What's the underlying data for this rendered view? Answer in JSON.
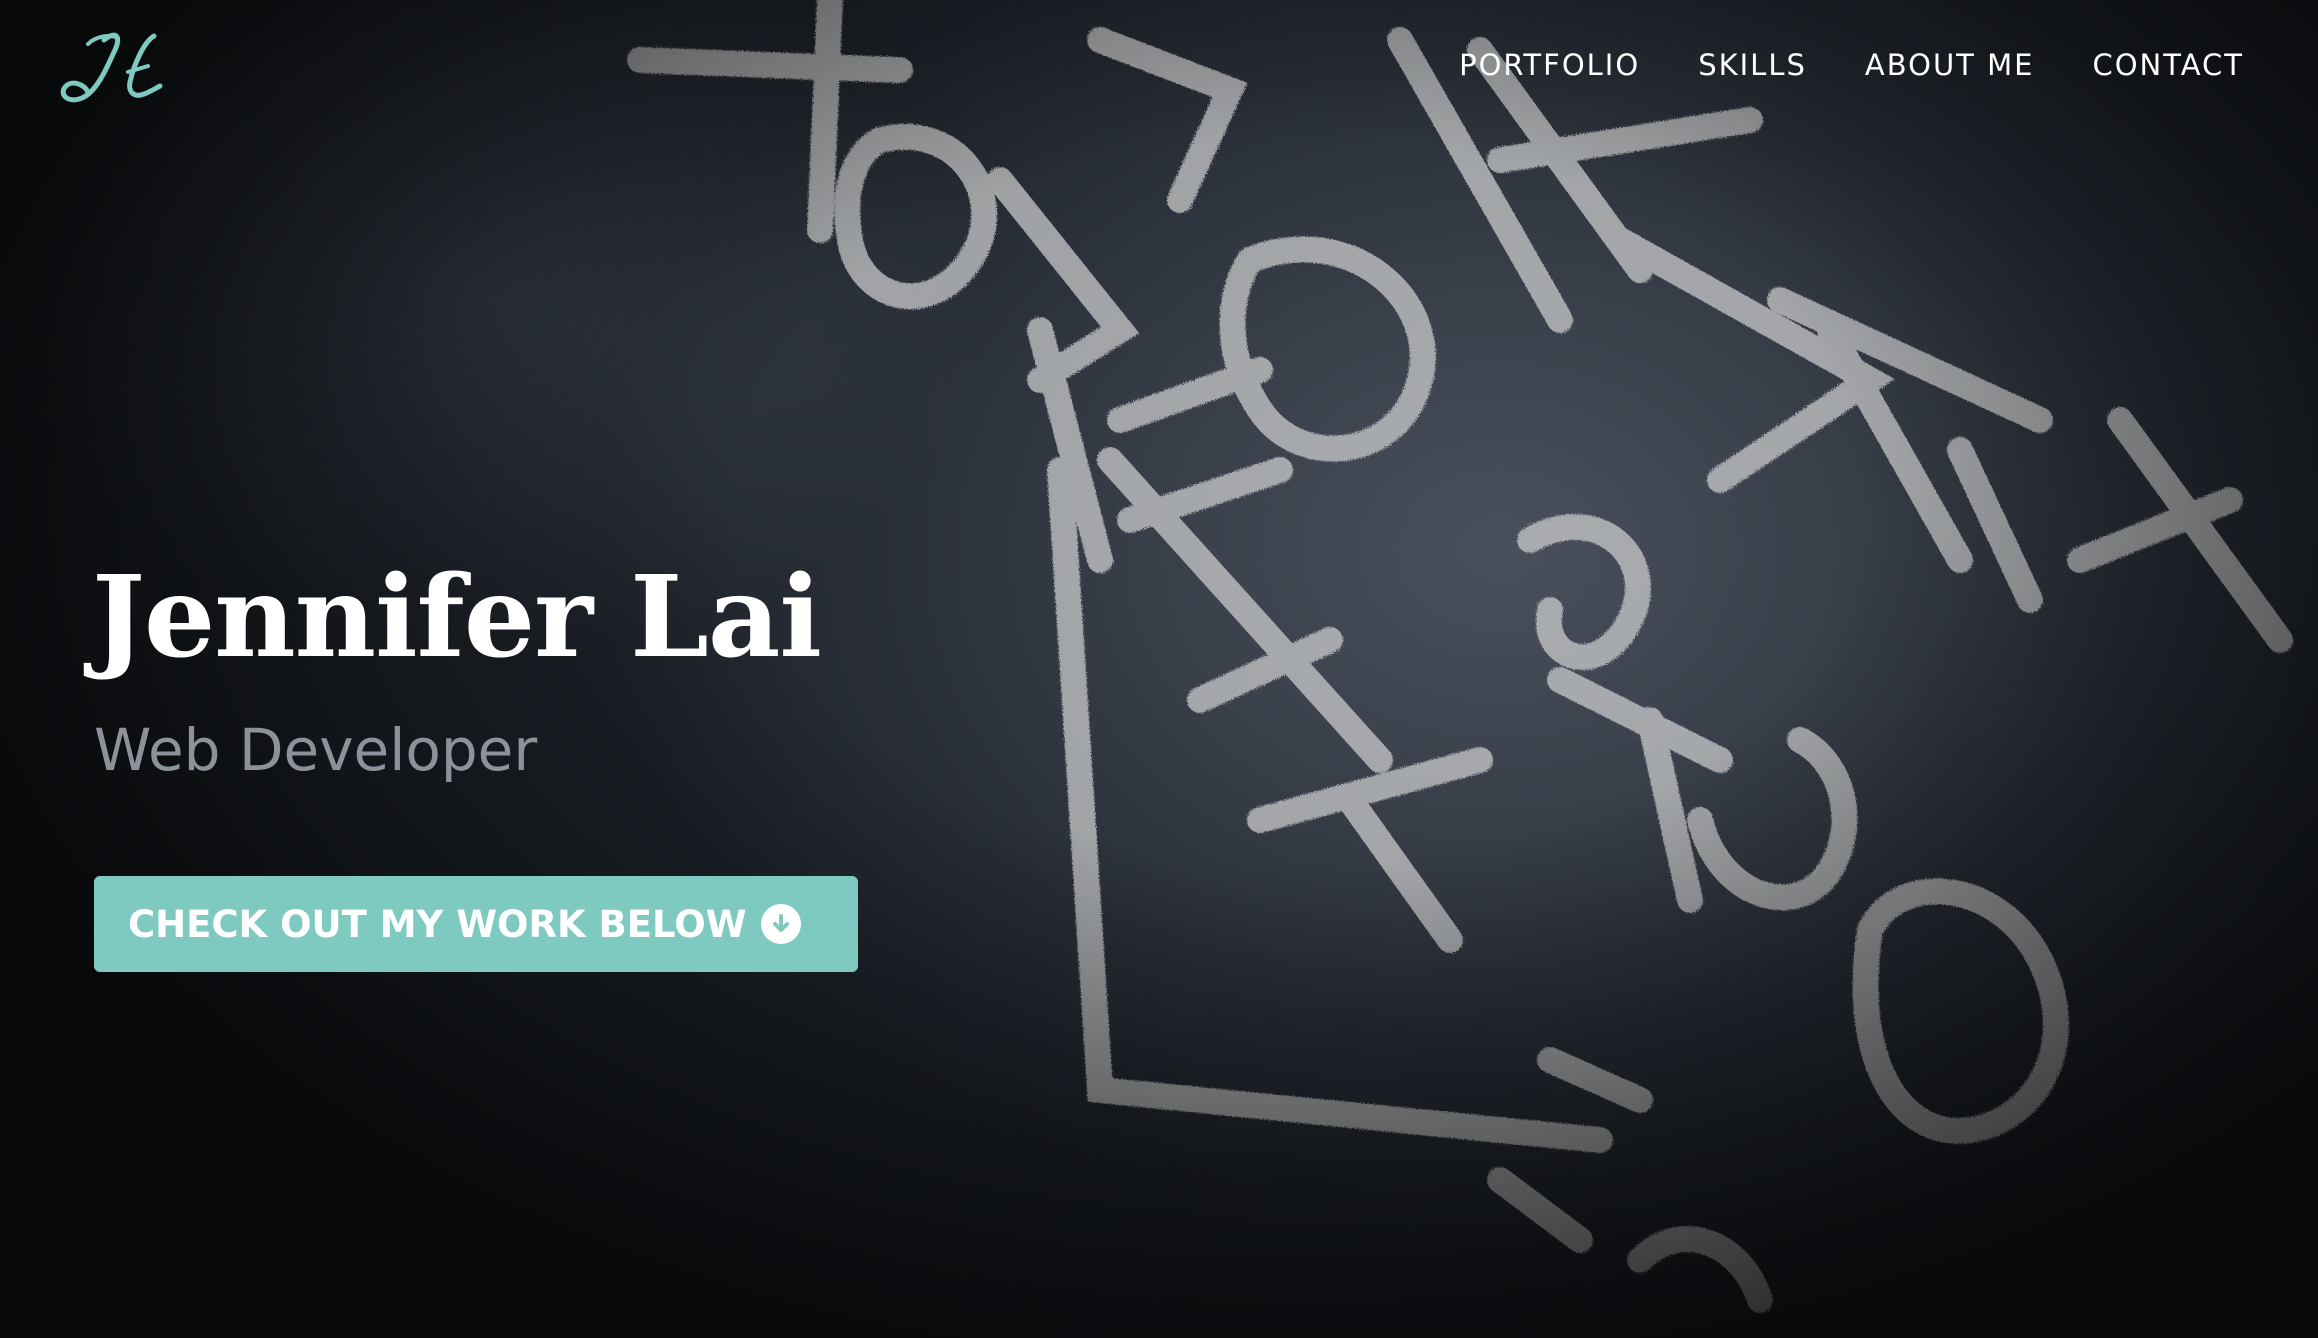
{
  "brand": {
    "logo_text": "JL",
    "accent_color": "#7fcac0"
  },
  "nav": {
    "items": [
      {
        "label": "PORTFOLIO"
      },
      {
        "label": "SKILLS"
      },
      {
        "label": "ABOUT ME"
      },
      {
        "label": "CONTACT"
      }
    ]
  },
  "hero": {
    "name": "Jennifer Lai",
    "title": "Web Developer",
    "cta_label": "CHECK OUT MY WORK BELOW",
    "cta_icon": "arrow-circle-down-icon"
  }
}
